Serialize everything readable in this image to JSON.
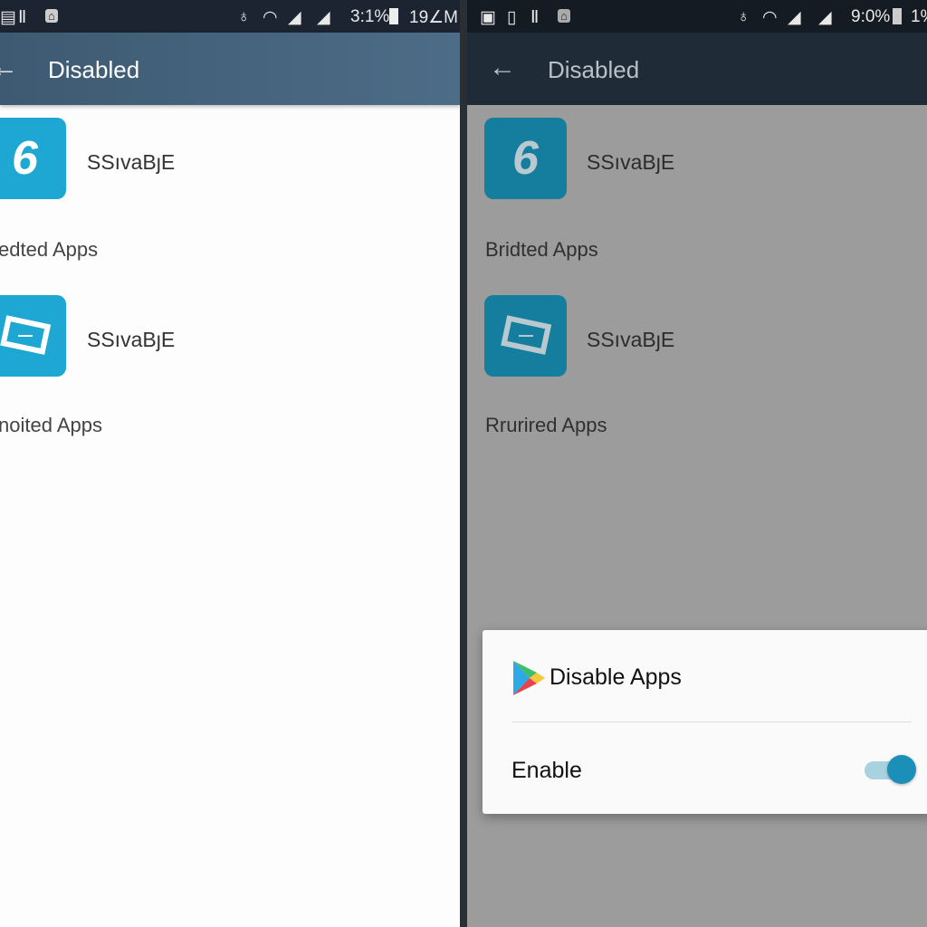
{
  "left": {
    "status": {
      "icons": [
        "sd-card-icon",
        "sim-icon",
        "usb-icon",
        "image-icon",
        "alarm-icon",
        "wifi-icon",
        "signal-icon",
        "signal-icon"
      ],
      "battery": "3:1%",
      "time": "19∠M"
    },
    "appbar": {
      "back_icon": "arrow-left-icon",
      "title": "Disabled"
    },
    "apps": [
      {
        "name": "SSıvaBȷE",
        "icon": "six-icon"
      },
      {
        "name": "SSıvaBȷE",
        "icon": "ticket-icon"
      }
    ],
    "sections": [
      "edted Apps",
      "noited Apps"
    ]
  },
  "right": {
    "status": {
      "battery": "9:0%",
      "time": "1%"
    },
    "appbar": {
      "back_icon": "arrow-left-icon",
      "title": "Disabled"
    },
    "apps": [
      {
        "name": "SSıvaBȷE",
        "icon": "six-icon"
      },
      {
        "name": "SSıvaBȷE",
        "icon": "ticket-icon"
      }
    ],
    "sections": [
      "Bridted Apps",
      "Rrurired Apps"
    ],
    "dialog": {
      "title": "Disable Apps",
      "icon": "play-store-icon",
      "toggle_label": "Enable",
      "toggle_on": true
    },
    "colors": {
      "accent": "#1b8fb8",
      "appbar": "#3e5a72"
    }
  }
}
